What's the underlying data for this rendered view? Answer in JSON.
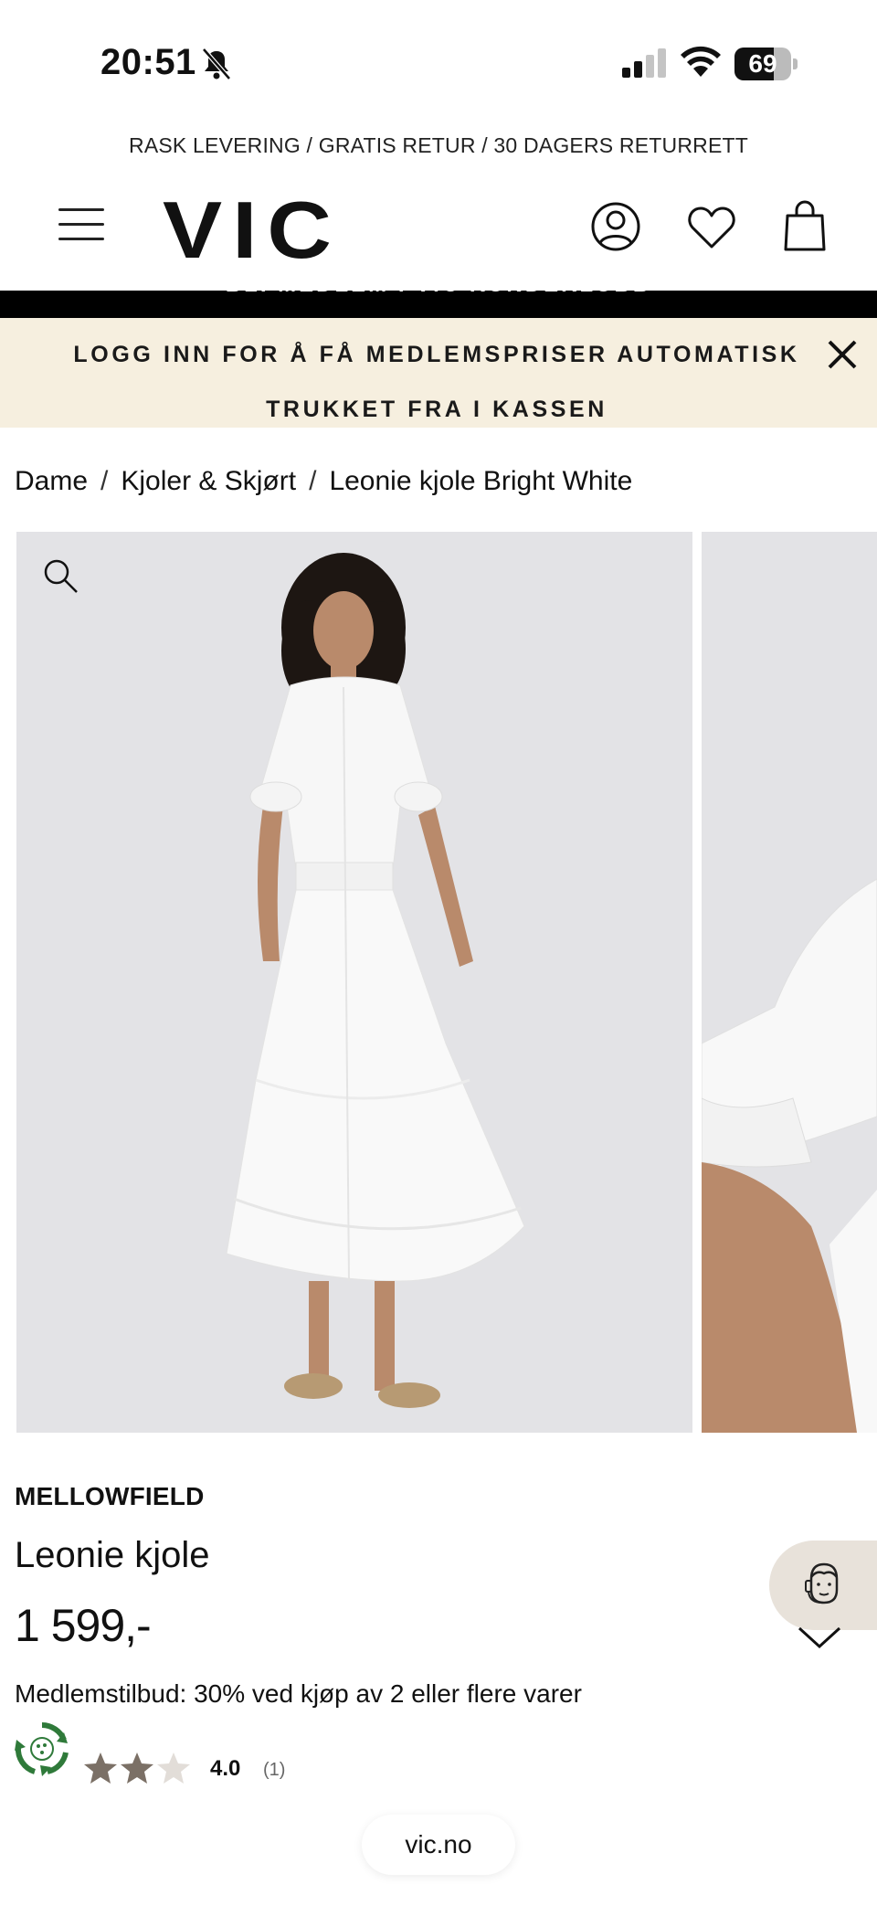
{
  "status_bar": {
    "time": "20:51",
    "battery": "69",
    "battery_level": 0.69
  },
  "promo": {
    "line": "RASK LEVERING / GRATIS RETUR / 30 DAGERS RETURRETT"
  },
  "header": {
    "logo": "VIC"
  },
  "member_banner": {
    "text": "BLI MEDLEM I VIC KUNDEKLUBB"
  },
  "login_notice": {
    "text": "LOGG INN FOR Å FÅ MEDLEMSPRISER AUTOMATISK TRUKKET FRA I KASSEN"
  },
  "breadcrumb": {
    "items": [
      "Dame",
      "Kjoler & Skjørt",
      "Leonie kjole Bright White"
    ],
    "separator": "/"
  },
  "product": {
    "brand": "MELLOWFIELD",
    "name": "Leonie kjole",
    "price": "1 599,-",
    "member_offer": "Medlemstilbud: 30% ved kjøp av 2 eller flere varer",
    "rating": "4.0",
    "rating_count": "(1)",
    "rating_stars": 3
  },
  "browser": {
    "url": "vic.no"
  },
  "colors": {
    "notice_bg": "#f6efdf",
    "star_filled": "#7b7066",
    "star_empty": "#e2ddd8",
    "eco_green": "#2f7a3a",
    "chat_bg": "#e8e2da"
  }
}
